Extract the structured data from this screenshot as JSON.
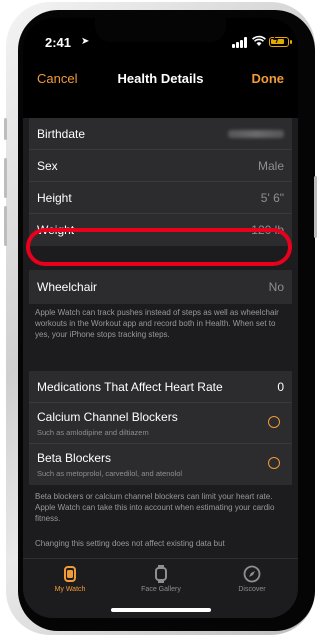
{
  "status_bar": {
    "time": "2:41",
    "icons": [
      "location-arrow-icon",
      "signal-icon",
      "wifi-icon",
      "battery-charging-icon"
    ]
  },
  "nav": {
    "cancel": "Cancel",
    "title": "Health Details",
    "done": "Done"
  },
  "details": {
    "birthdate_label": "Birthdate",
    "sex_label": "Sex",
    "sex_value": "Male",
    "height_label": "Height",
    "height_value": "5' 6\"",
    "weight_label": "Weight",
    "weight_value": "120 lb"
  },
  "wheelchair": {
    "label": "Wheelchair",
    "value": "No",
    "footnote": "Apple Watch can track pushes instead of steps as well as wheelchair workouts in the Workout app and record both in Health. When set to yes, your iPhone stops tracking steps."
  },
  "medications": {
    "header_label": "Medications That Affect Heart Rate",
    "header_value": "0",
    "items": [
      {
        "title": "Calcium Channel Blockers",
        "subtitle": "Such as amlodipine and diltiazem"
      },
      {
        "title": "Beta Blockers",
        "subtitle": "Such as metoprolol, carvedilol, and atenolol"
      }
    ],
    "footnote": "Beta blockers or calcium channel blockers can limit your heart rate. Apple Watch can take this into account when estimating your cardio fitness.",
    "footnote2": "Changing this setting does not affect existing data but"
  },
  "tabbar": {
    "tabs": [
      {
        "label": "My Watch",
        "icon": "watch-icon"
      },
      {
        "label": "Face Gallery",
        "icon": "watch-face-icon"
      },
      {
        "label": "Discover",
        "icon": "compass-icon"
      }
    ]
  },
  "colors": {
    "accent": "#f19a38",
    "highlight": "#e8001c",
    "background": "#1c1c1e",
    "cell": "#2c2c2e"
  }
}
